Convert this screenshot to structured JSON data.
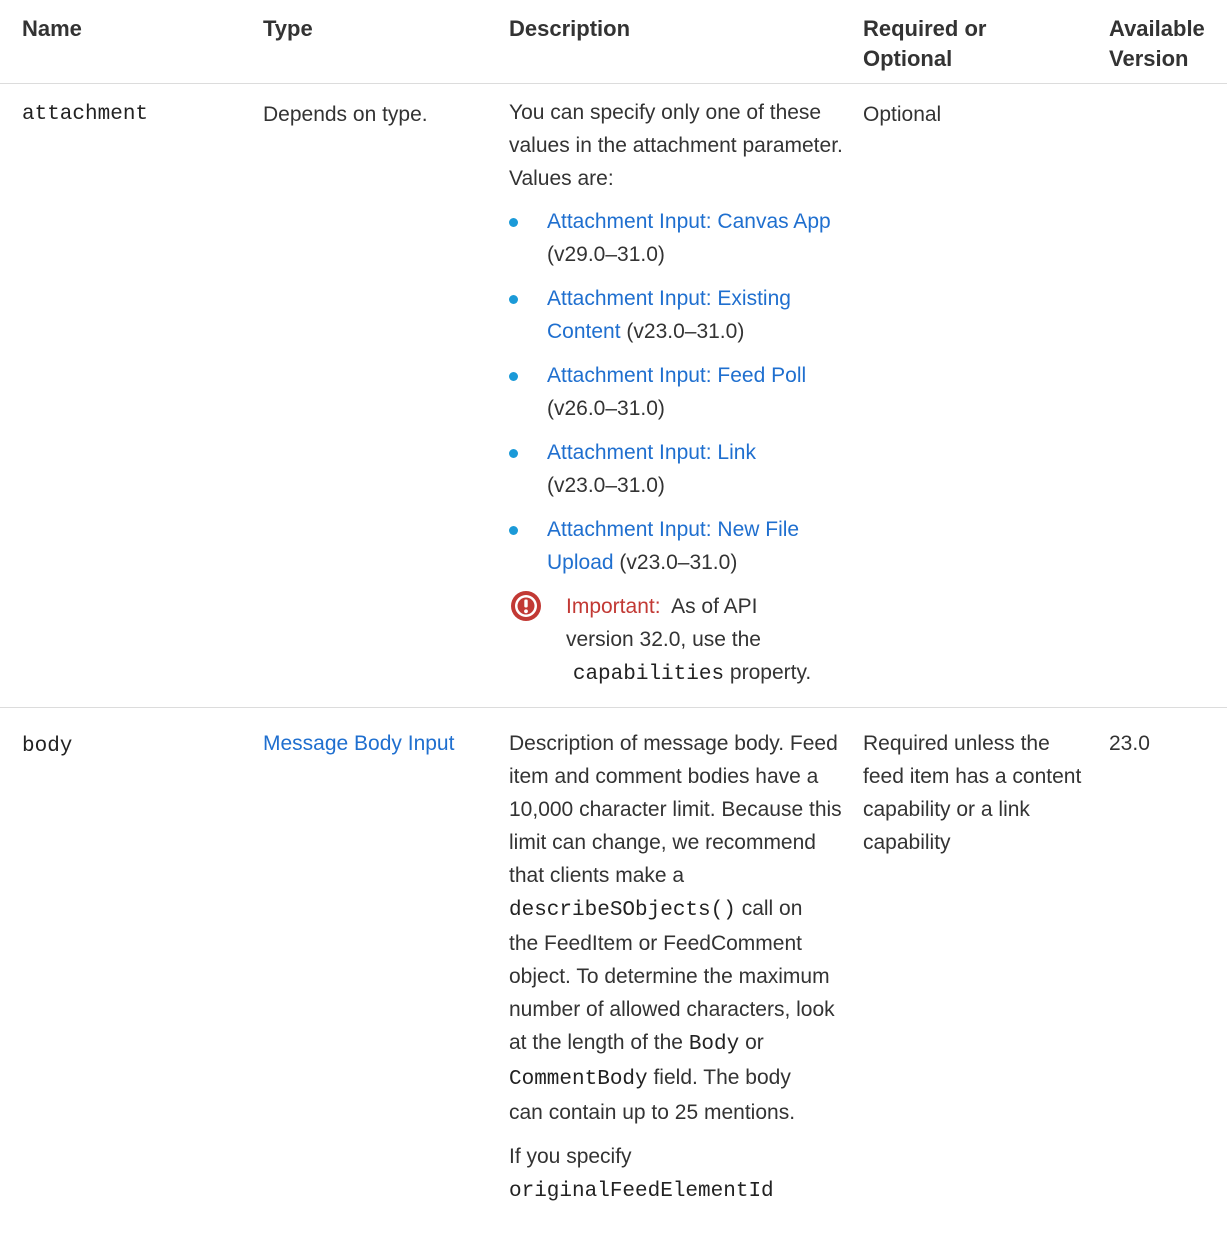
{
  "headers": {
    "name": "Name",
    "type": "Type",
    "description": "Description",
    "required_line1": "Required or",
    "required_line2": "Optional",
    "version_line1": "Available",
    "version_line2": "Version"
  },
  "rows": [
    {
      "name": "attachment",
      "type": "Depends on type.",
      "desc_lines": [
        "You can specify only one of these",
        "values in the attachment parameter.",
        "Values are:"
      ],
      "options": [
        {
          "link_lines": [
            "Attachment Input: Canvas App"
          ],
          "tail_text": "(v29.0–31.0)",
          "tail_newline": true
        },
        {
          "link_lines": [
            "Attachment Input: Existing",
            "Content"
          ],
          "tail_text": "(v23.0–31.0)",
          "tail_newline": false
        },
        {
          "link_lines": [
            "Attachment Input: Feed Poll"
          ],
          "tail_text": "(v26.0–31.0)",
          "tail_newline": true
        },
        {
          "link_lines": [
            "Attachment Input: Link"
          ],
          "tail_text": "(v23.0–31.0)",
          "tail_newline": true
        },
        {
          "link_lines": [
            "Attachment Input: New File",
            "Upload"
          ],
          "tail_text": "(v23.0–31.0)",
          "tail_newline": false
        }
      ],
      "important": {
        "label": "Important:",
        "line1": "As of API",
        "line2": "version 32.0, use the",
        "code": "capabilities",
        "tail": "property."
      },
      "required": "Optional",
      "version": ""
    },
    {
      "name": "body",
      "type": "Message Body Input",
      "desc_lines": [
        "Description of message body. Feed",
        "item and comment bodies have a",
        "10,000 character limit. Because this",
        "limit can change, we recommend",
        "that clients make a"
      ],
      "desc_code1": "describeSObjects()",
      "desc_code1_tail": "call on",
      "desc_lines2": [
        "the FeedItem or FeedComment",
        "object. To determine the maximum",
        "number of allowed characters, look",
        "at the length of the"
      ],
      "desc_code2": "Body",
      "desc_code2_tail": "or",
      "desc_code3": "CommentBody",
      "desc_code3_tail": "field. The body",
      "desc_last": "can contain up to 25 mentions.",
      "desc2_line1": "If you specify",
      "desc2_code": "originalFeedElementId",
      "required_lines": [
        "Required unless the",
        "feed item has a content",
        "capability or a link",
        "capability"
      ],
      "version": "23.0"
    }
  ]
}
